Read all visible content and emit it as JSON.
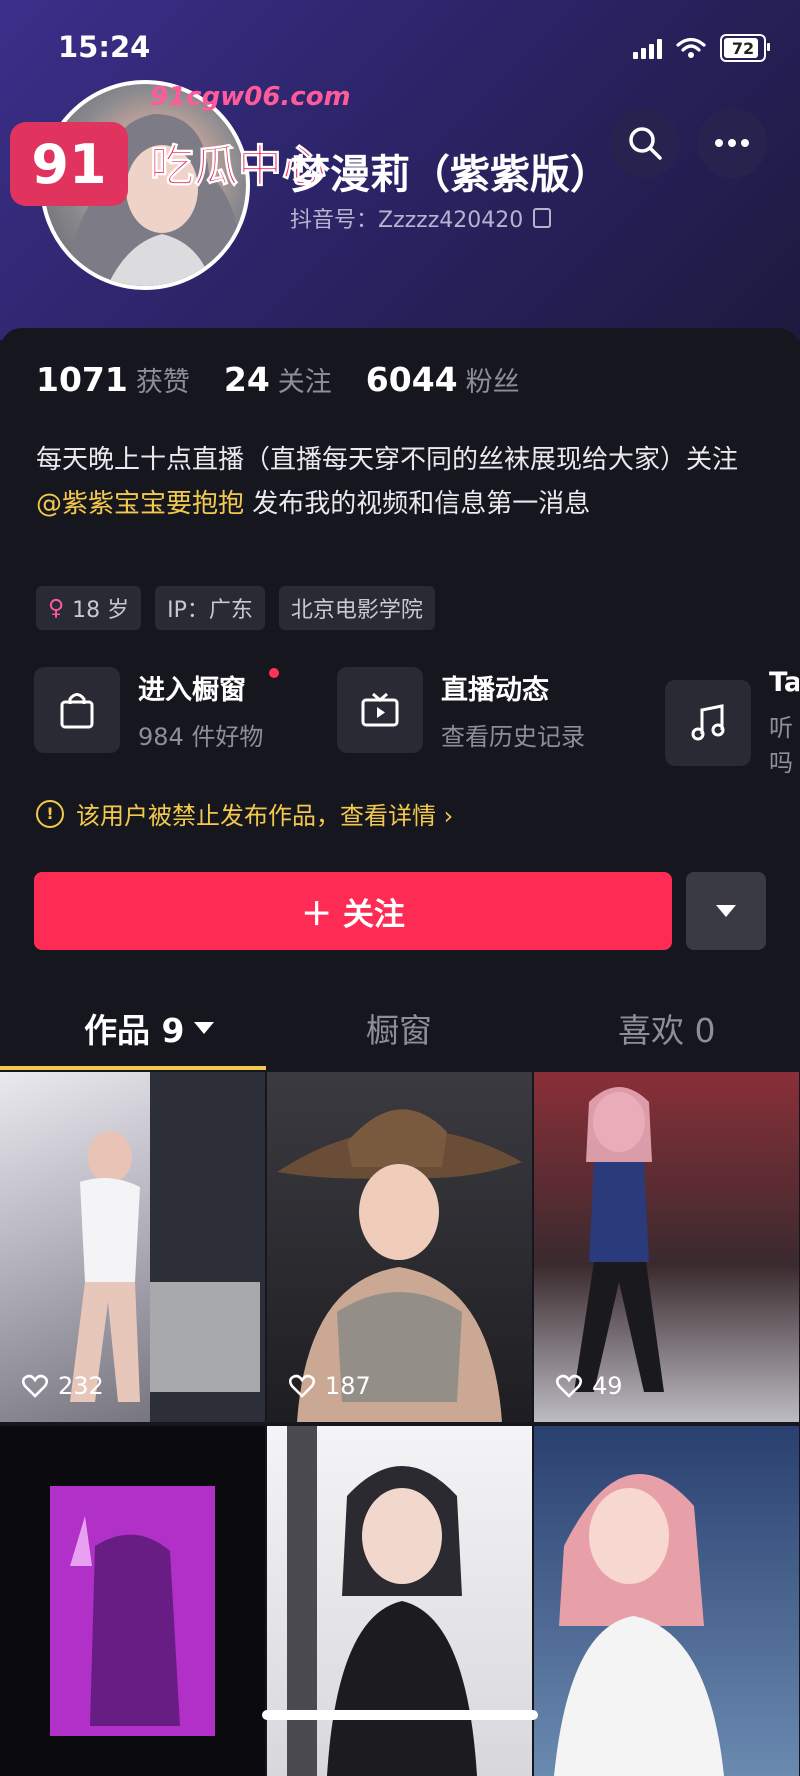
{
  "status": {
    "time": "15:24",
    "battery": "72"
  },
  "watermark": {
    "badge": "91",
    "url": "91cgw06.com",
    "title": "吃瓜中心"
  },
  "profile": {
    "name": "梦漫莉（紫紫版）",
    "handle": "抖音号：Zzzzz420420"
  },
  "stats": [
    {
      "value": "1071",
      "label": "获赞"
    },
    {
      "value": "24",
      "label": "关注"
    },
    {
      "value": "6044",
      "label": "粉丝"
    }
  ],
  "bio": {
    "line_before": "每天晚上十点直播（直播每天穿不同的丝袜展现给大家）关注 ",
    "mention": "@紫紫宝宝要抱抱",
    "line_after": " 发布我的视频和信息第一消息"
  },
  "tags": {
    "age": "18 岁",
    "ip": "IP：广东",
    "school": "北京电影学院"
  },
  "features": [
    {
      "title": "进入橱窗",
      "sub": "984 件好物",
      "icon": "bag-icon"
    },
    {
      "title": "直播动态",
      "sub": "查看历史记录",
      "icon": "tv-icon"
    },
    {
      "title": "Ta",
      "sub": "听吗",
      "icon": "music-icon"
    }
  ],
  "notice": "该用户被禁止发布作品，查看详情 ›",
  "follow_label": "＋ 关注",
  "tabs": {
    "works": "作品 9",
    "shop": "橱窗",
    "likes": "喜欢 0"
  },
  "thumbs": [
    {
      "likes": "232"
    },
    {
      "likes": "187"
    },
    {
      "likes": "49"
    },
    {
      "likes": ""
    },
    {
      "likes": ""
    },
    {
      "likes": ""
    }
  ],
  "colors": {
    "accent": "#fe2c55",
    "gold": "#f2c94c",
    "bg": "#16161f"
  }
}
